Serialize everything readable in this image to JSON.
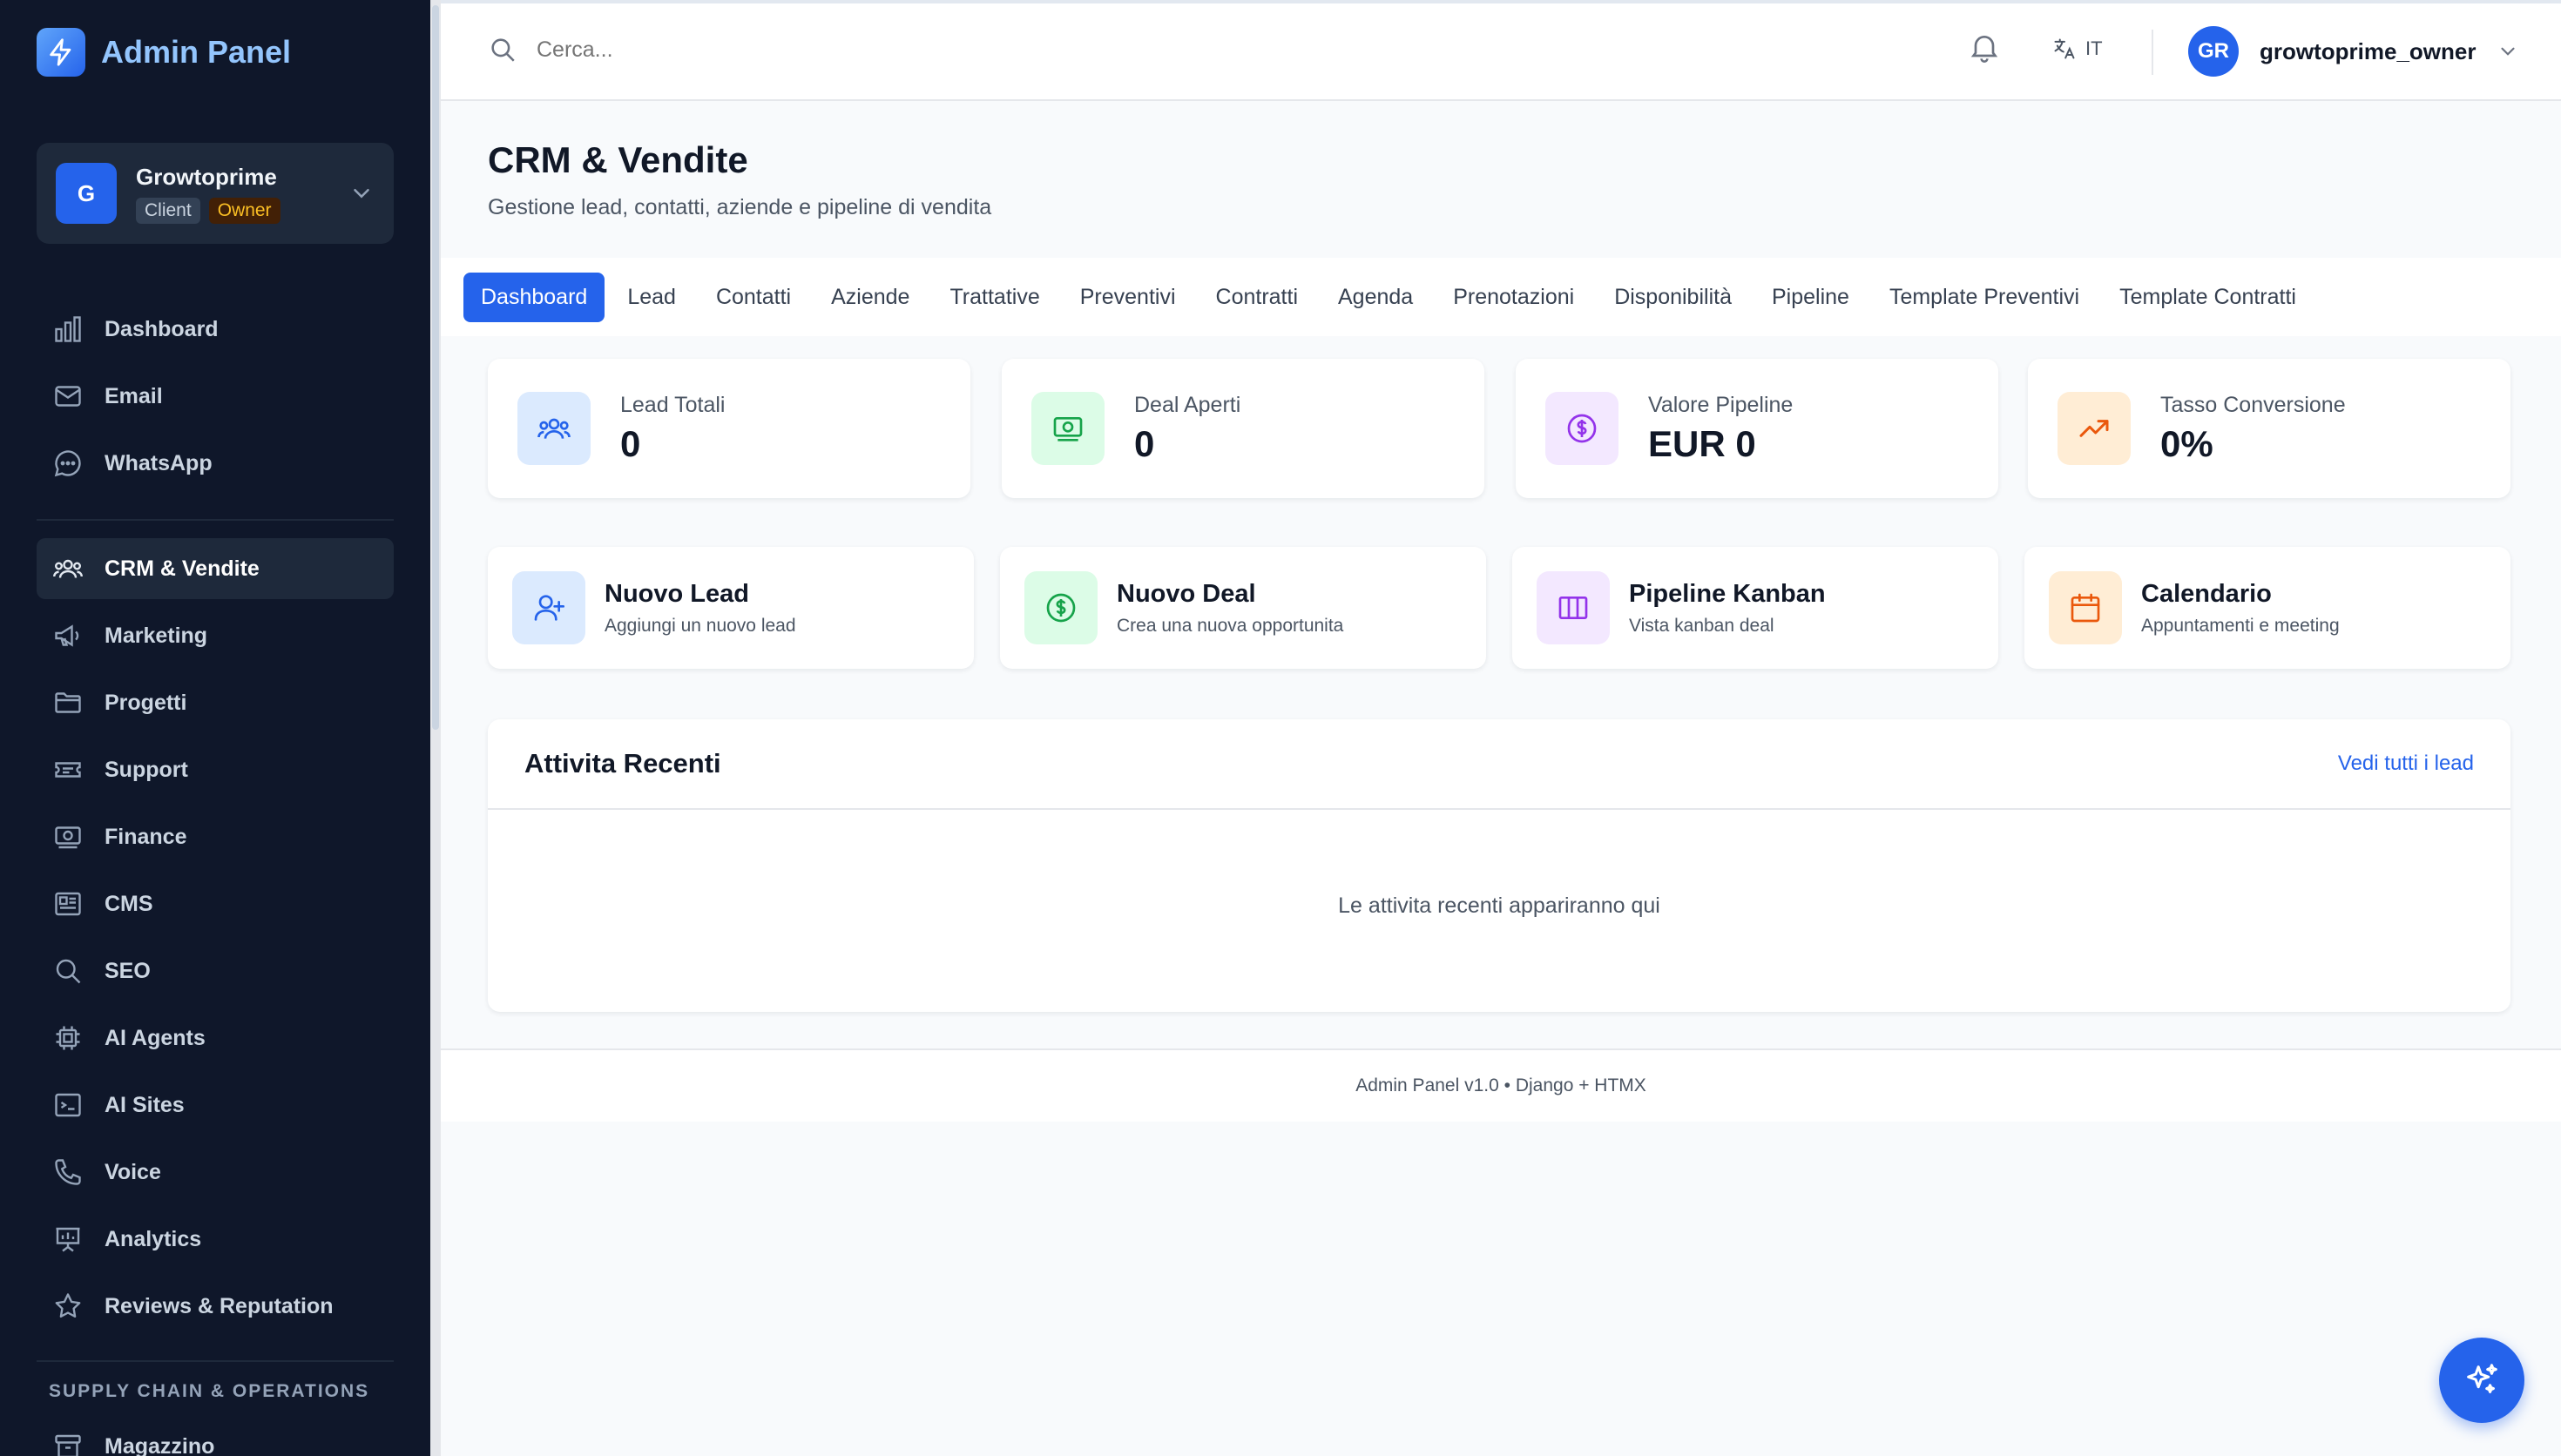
{
  "brand": {
    "title": "Admin Panel"
  },
  "org": {
    "initial": "G",
    "name": "Growtoprime",
    "badge_client": "Client",
    "badge_owner": "Owner"
  },
  "sidebar": {
    "items": [
      {
        "label": "Dashboard",
        "icon": "bar-chart-icon"
      },
      {
        "label": "Email",
        "icon": "mail-icon"
      },
      {
        "label": "WhatsApp",
        "icon": "chat-icon"
      },
      {
        "label": "CRM & Vendite",
        "icon": "users-icon",
        "active": true
      },
      {
        "label": "Marketing",
        "icon": "megaphone-icon"
      },
      {
        "label": "Progetti",
        "icon": "folder-icon"
      },
      {
        "label": "Support",
        "icon": "ticket-icon"
      },
      {
        "label": "Finance",
        "icon": "banknote-icon"
      },
      {
        "label": "CMS",
        "icon": "newspaper-icon"
      },
      {
        "label": "SEO",
        "icon": "search-icon"
      },
      {
        "label": "AI Agents",
        "icon": "cpu-icon"
      },
      {
        "label": "AI Sites",
        "icon": "terminal-icon"
      },
      {
        "label": "Voice",
        "icon": "phone-icon"
      },
      {
        "label": "Analytics",
        "icon": "presentation-icon"
      },
      {
        "label": "Reviews & Reputation",
        "icon": "star-icon"
      }
    ],
    "section_label": "SUPPLY CHAIN & OPERATIONS",
    "section_items": [
      {
        "label": "Magazzino",
        "icon": "archive-icon"
      }
    ]
  },
  "topbar": {
    "search_placeholder": "Cerca...",
    "language": "IT",
    "user_initials": "GR",
    "username": "growtoprime_owner"
  },
  "page": {
    "title": "CRM & Vendite",
    "subtitle": "Gestione lead, contatti, aziende e pipeline di vendita"
  },
  "tabs": [
    "Dashboard",
    "Lead",
    "Contatti",
    "Aziende",
    "Trattative",
    "Preventivi",
    "Contratti",
    "Agenda",
    "Prenotazioni",
    "Disponibilità",
    "Pipeline",
    "Template Preventivi",
    "Template Contratti"
  ],
  "stats": [
    {
      "label": "Lead Totali",
      "value": "0"
    },
    {
      "label": "Deal Aperti",
      "value": "0"
    },
    {
      "label": "Valore Pipeline",
      "value": "EUR 0"
    },
    {
      "label": "Tasso Conversione",
      "value": "0%"
    }
  ],
  "actions": [
    {
      "title": "Nuovo Lead",
      "desc": "Aggiungi un nuovo lead"
    },
    {
      "title": "Nuovo Deal",
      "desc": "Crea una nuova opportunita"
    },
    {
      "title": "Pipeline Kanban",
      "desc": "Vista kanban deal"
    },
    {
      "title": "Calendario",
      "desc": "Appuntamenti e meeting"
    }
  ],
  "recent": {
    "title": "Attivita Recenti",
    "link": "Vedi tutti i lead",
    "empty": "Le attivita recenti appariranno qui"
  },
  "footer": {
    "text": "Admin Panel v1.0 • Django + HTMX"
  },
  "colors": {
    "accent": "#2563eb",
    "sidebar_bg": "#0f172a",
    "blue_soft": "#dbeafe",
    "green_soft": "#dcfce7",
    "purple_soft": "#f3e8ff",
    "orange_soft": "#ffedd5"
  }
}
